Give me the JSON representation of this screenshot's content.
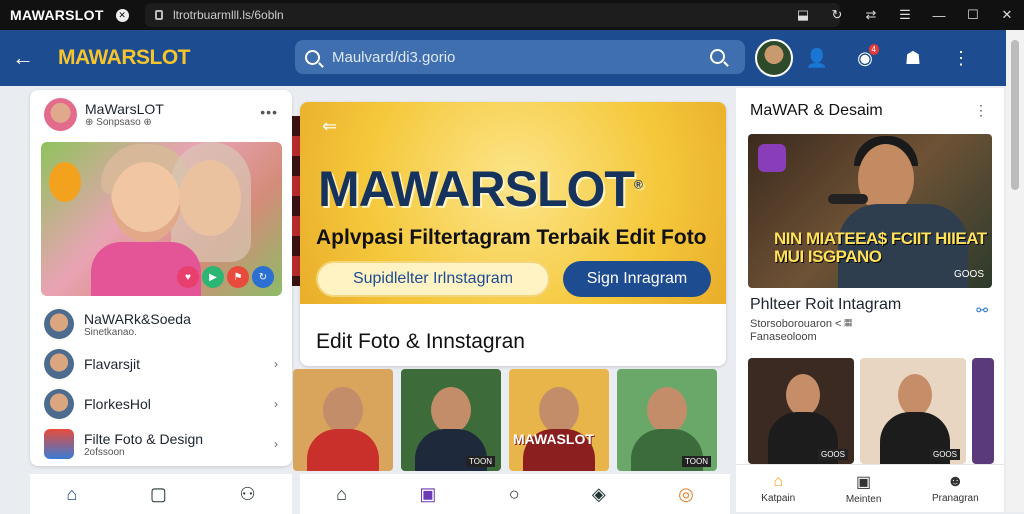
{
  "browser": {
    "tab_title": "MAWARSLOT",
    "address": "ltrotrbuarmlll.ls/6obln",
    "icons": [
      "extension-icon",
      "refresh-icon",
      "bookmark-icon",
      "menu-icon",
      "minimize-icon",
      "maximize-icon",
      "close-icon"
    ]
  },
  "header": {
    "logo": "MAWARSLOT",
    "search_value": "Maulvard/di3.gorio",
    "notif_count": "4"
  },
  "left_card": {
    "name": "MaWarsLOT",
    "sub": "⊕ Sonpsaso ⊕",
    "list": [
      {
        "title": "NaWARk&Soeda",
        "sub": "Sinetkanao."
      },
      {
        "title": "Flavarsjit",
        "sub": ""
      },
      {
        "title": "FlorkesHol",
        "sub": ""
      },
      {
        "title": "Filte Foto & Design",
        "sub": "2ofssoon"
      }
    ]
  },
  "hero": {
    "brand": "MAWARSLOT",
    "tagline": "Aplvpasi Filtertagram Terbaik Edit Foto",
    "btn_outline": "Supidlelter Irlnstagram",
    "btn_solid": "Sign Inragram",
    "section_title": "Edit Foto & Innstagran"
  },
  "thumbs": [
    {
      "tag": "",
      "big": "",
      "bg": "#d9a45c",
      "shirt": "#c9302c"
    },
    {
      "tag": "TOON",
      "big": "",
      "bg": "#3d6b3a",
      "shirt": "#1e2a3c"
    },
    {
      "tag": "",
      "big": "MAWASLOT",
      "bg": "#e7b54a",
      "shirt": "#8b1e1e"
    },
    {
      "tag": "TOON",
      "big": "",
      "bg": "#6aa86a",
      "shirt": "#3c6b3c"
    }
  ],
  "right": {
    "title": "MaWAR & Desaim",
    "overlay": "NIN MIATEEA$ FCIIT HIIEAT MUI ISGPANO",
    "image_tag": "GOOS",
    "post_title": "Phlteer Roit Intagram",
    "post_sub1": "Storsoborouaron < 𝄜",
    "post_sub2": "Fanaseoloom",
    "thumbs": [
      {
        "tag": "GOOS",
        "bg": "#3a2a22"
      },
      {
        "tag": "GOOS",
        "bg": "#e8d6c2"
      }
    ],
    "nav": [
      {
        "label": "Katpain",
        "icon": "⌂"
      },
      {
        "label": "Meinten",
        "icon": "▣"
      },
      {
        "label": "Pranagran",
        "icon": "☻"
      }
    ]
  },
  "colors": {
    "header": "#1d4c91",
    "accent": "#f6c52c"
  }
}
